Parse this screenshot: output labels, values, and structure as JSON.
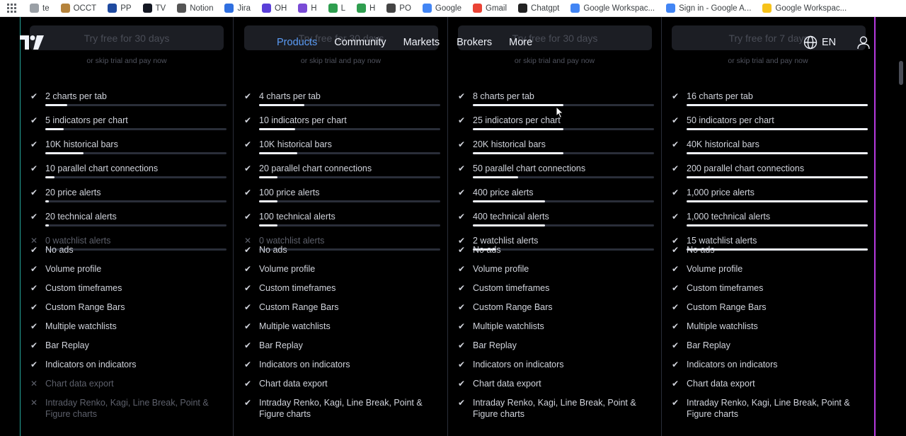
{
  "bookmarks": [
    {
      "label": "te",
      "icon": "te-favicon",
      "color": "#9aa0a6"
    },
    {
      "label": "OCCT",
      "icon": "occt-favicon",
      "color": "#b5833b"
    },
    {
      "label": "PP",
      "icon": "paypal-favicon",
      "color": "#1f4aa0"
    },
    {
      "label": "TV",
      "icon": "tradingview-favicon",
      "color": "#131722"
    },
    {
      "label": "Notion",
      "icon": "home-favicon",
      "color": "#555555"
    },
    {
      "label": "Jira",
      "icon": "jira-favicon",
      "color": "#2f6fe0"
    },
    {
      "label": "OH",
      "icon": "oh-favicon",
      "color": "#5a3fd8"
    },
    {
      "label": "H",
      "icon": "h-purple-favicon",
      "color": "#7a4bd6"
    },
    {
      "label": "L",
      "icon": "sheets-favicon",
      "color": "#2f9e4f"
    },
    {
      "label": "H",
      "icon": "sheets-favicon-2",
      "color": "#2f9e4f"
    },
    {
      "label": "PO",
      "icon": "globe-favicon",
      "color": "#444444"
    },
    {
      "label": "Google",
      "icon": "google-favicon",
      "color": "#4285f4"
    },
    {
      "label": "Gmail",
      "icon": "gmail-favicon",
      "color": "#ea4335"
    },
    {
      "label": "Chatgpt",
      "icon": "chatgpt-favicon",
      "color": "#222222"
    },
    {
      "label": "Google Workspac...",
      "icon": "google-favicon-2",
      "color": "#4285f4"
    },
    {
      "label": "Sign in - Google A...",
      "icon": "google-favicon-3",
      "color": "#4285f4"
    },
    {
      "label": "Google Workspac...",
      "icon": "keep-favicon",
      "color": "#f6c21a"
    }
  ],
  "header": {
    "nav": [
      "Products",
      "Community",
      "Markets",
      "Brokers",
      "More"
    ],
    "active": "Products",
    "lang": "EN"
  },
  "colors": {
    "accent": "#5b9cf6",
    "left_border": "#26a69a",
    "right_border": "#b63adf"
  },
  "plans": [
    {
      "trial": "Try free for 30 days",
      "skip": "or skip trial and pay now",
      "metered": [
        {
          "label": "2 charts per tab",
          "level": 0.12,
          "on": true
        },
        {
          "label": "5 indicators per chart",
          "level": 0.1,
          "on": true
        },
        {
          "label": "10K historical bars",
          "level": 0.21,
          "on": true
        },
        {
          "label": "10 parallel chart connections",
          "level": 0.05,
          "on": true
        },
        {
          "label": "20 price alerts",
          "level": 0.02,
          "on": true
        },
        {
          "label": "20 technical alerts",
          "level": 0.02,
          "on": true
        },
        {
          "label": "0 watchlist alerts",
          "level": 0,
          "on": false
        }
      ],
      "features": [
        {
          "label": "No ads",
          "on": true
        },
        {
          "label": "Volume profile",
          "on": true
        },
        {
          "label": "Custom timeframes",
          "on": true
        },
        {
          "label": "Custom Range Bars",
          "on": true
        },
        {
          "label": "Multiple watchlists",
          "on": true
        },
        {
          "label": "Bar Replay",
          "on": true
        },
        {
          "label": "Indicators on indicators",
          "on": true
        },
        {
          "label": "Chart data export",
          "on": false
        },
        {
          "label": "Intraday Renko, Kagi, Line Break, Point & Figure charts",
          "on": false
        }
      ]
    },
    {
      "trial": "Try free for 30 days",
      "skip": "or skip trial and pay now",
      "metered": [
        {
          "label": "4 charts per tab",
          "level": 0.25,
          "on": true
        },
        {
          "label": "10 indicators per chart",
          "level": 0.2,
          "on": true
        },
        {
          "label": "10K historical bars",
          "level": 0.21,
          "on": true
        },
        {
          "label": "20 parallel chart connections",
          "level": 0.1,
          "on": true
        },
        {
          "label": "100 price alerts",
          "level": 0.1,
          "on": true
        },
        {
          "label": "100 technical alerts",
          "level": 0.1,
          "on": true
        },
        {
          "label": "0 watchlist alerts",
          "level": 0,
          "on": false
        }
      ],
      "features": [
        {
          "label": "No ads",
          "on": true
        },
        {
          "label": "Volume profile",
          "on": true
        },
        {
          "label": "Custom timeframes",
          "on": true
        },
        {
          "label": "Custom Range Bars",
          "on": true
        },
        {
          "label": "Multiple watchlists",
          "on": true
        },
        {
          "label": "Bar Replay",
          "on": true
        },
        {
          "label": "Indicators on indicators",
          "on": true
        },
        {
          "label": "Chart data export",
          "on": true
        },
        {
          "label": "Intraday Renko, Kagi, Line Break, Point & Figure charts",
          "on": true
        }
      ]
    },
    {
      "trial": "Try free for 30 days",
      "skip": "or skip trial and pay now",
      "metered": [
        {
          "label": "8 charts per tab",
          "level": 0.5,
          "on": true
        },
        {
          "label": "25 indicators per chart",
          "level": 0.5,
          "on": true
        },
        {
          "label": "20K historical bars",
          "level": 0.5,
          "on": true
        },
        {
          "label": "50 parallel chart connections",
          "level": 0.25,
          "on": true
        },
        {
          "label": "400 price alerts",
          "level": 0.4,
          "on": true
        },
        {
          "label": "400 technical alerts",
          "level": 0.4,
          "on": true
        },
        {
          "label": "2 watchlist alerts",
          "level": 0.13,
          "on": true
        }
      ],
      "features": [
        {
          "label": "No ads",
          "on": true
        },
        {
          "label": "Volume profile",
          "on": true
        },
        {
          "label": "Custom timeframes",
          "on": true
        },
        {
          "label": "Custom Range Bars",
          "on": true
        },
        {
          "label": "Multiple watchlists",
          "on": true
        },
        {
          "label": "Bar Replay",
          "on": true
        },
        {
          "label": "Indicators on indicators",
          "on": true
        },
        {
          "label": "Chart data export",
          "on": true
        },
        {
          "label": "Intraday Renko, Kagi, Line Break, Point & Figure charts",
          "on": true
        }
      ]
    },
    {
      "trial": "Try free for 7 days",
      "skip": "or skip trial and pay now",
      "metered": [
        {
          "label": "16 charts per tab",
          "level": 1,
          "on": true
        },
        {
          "label": "50 indicators per chart",
          "level": 1,
          "on": true
        },
        {
          "label": "40K historical bars",
          "level": 1,
          "on": true
        },
        {
          "label": "200 parallel chart connections",
          "level": 1,
          "on": true
        },
        {
          "label": "1,000 price alerts",
          "level": 1,
          "on": true
        },
        {
          "label": "1,000 technical alerts",
          "level": 1,
          "on": true
        },
        {
          "label": "15 watchlist alerts",
          "level": 1,
          "on": true
        }
      ],
      "features": [
        {
          "label": "No ads",
          "on": true
        },
        {
          "label": "Volume profile",
          "on": true
        },
        {
          "label": "Custom timeframes",
          "on": true
        },
        {
          "label": "Custom Range Bars",
          "on": true
        },
        {
          "label": "Multiple watchlists",
          "on": true
        },
        {
          "label": "Bar Replay",
          "on": true
        },
        {
          "label": "Indicators on indicators",
          "on": true
        },
        {
          "label": "Chart data export",
          "on": true
        },
        {
          "label": "Intraday Renko, Kagi, Line Break, Point & Figure charts",
          "on": true
        }
      ]
    }
  ]
}
